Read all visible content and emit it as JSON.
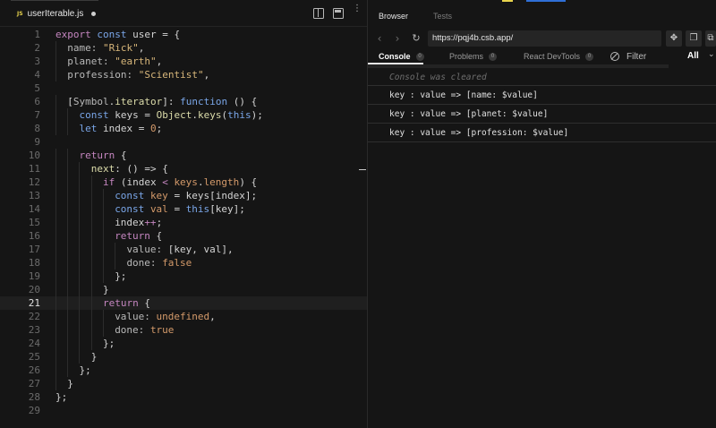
{
  "editor": {
    "tab": {
      "badge": "JS",
      "filename": "userIterable.js"
    },
    "active_line": 21,
    "lines": [
      {
        "n": "1",
        "indent": 0,
        "tokens": [
          [
            "k",
            "export "
          ],
          [
            "kv",
            "const "
          ],
          [
            "p",
            "user = {"
          ]
        ]
      },
      {
        "n": "2",
        "indent": 2,
        "tokens": [
          [
            "pr",
            "name: "
          ],
          [
            "s",
            "\"Rick\""
          ],
          [
            "p",
            ","
          ]
        ]
      },
      {
        "n": "3",
        "indent": 2,
        "tokens": [
          [
            "pr",
            "planet: "
          ],
          [
            "s",
            "\"earth\""
          ],
          [
            "p",
            ","
          ]
        ]
      },
      {
        "n": "4",
        "indent": 2,
        "tokens": [
          [
            "pr",
            "profession: "
          ],
          [
            "s",
            "\"Scientist\""
          ],
          [
            "p",
            ","
          ]
        ]
      },
      {
        "n": "5",
        "indent": 0,
        "tokens": []
      },
      {
        "n": "6",
        "indent": 2,
        "tokens": [
          [
            "p",
            "["
          ],
          [
            "pr",
            "Symbol"
          ],
          [
            "p",
            "."
          ],
          [
            "f",
            "iterator"
          ],
          [
            "p",
            "]: "
          ],
          [
            "kv",
            "function "
          ],
          [
            "p",
            "() {"
          ]
        ]
      },
      {
        "n": "7",
        "indent": 4,
        "tokens": [
          [
            "kv",
            "const "
          ],
          [
            "p",
            "keys = "
          ],
          [
            "f",
            "Object"
          ],
          [
            "p",
            "."
          ],
          [
            "f",
            "keys"
          ],
          [
            "p",
            "("
          ],
          [
            "kv",
            "this"
          ],
          [
            "p",
            ");"
          ]
        ]
      },
      {
        "n": "8",
        "indent": 4,
        "tokens": [
          [
            "kv",
            "let "
          ],
          [
            "p",
            "index = "
          ],
          [
            "v",
            "0"
          ],
          [
            "p",
            ";"
          ]
        ]
      },
      {
        "n": "9",
        "indent": 0,
        "tokens": []
      },
      {
        "n": "10",
        "indent": 4,
        "tokens": [
          [
            "k",
            "return "
          ],
          [
            "p",
            "{"
          ]
        ]
      },
      {
        "n": "11",
        "indent": 6,
        "tokens": [
          [
            "f",
            "next"
          ],
          [
            "p",
            ": () => {"
          ]
        ]
      },
      {
        "n": "12",
        "indent": 8,
        "tokens": [
          [
            "k",
            "if "
          ],
          [
            "p",
            "(index "
          ],
          [
            "op",
            "< "
          ],
          [
            "v",
            "keys"
          ],
          [
            "p",
            "."
          ],
          [
            "v",
            "length"
          ],
          [
            "p",
            ") {"
          ]
        ]
      },
      {
        "n": "13",
        "indent": 10,
        "tokens": [
          [
            "kv",
            "const "
          ],
          [
            "v",
            "key "
          ],
          [
            "p",
            "= keys[index];"
          ]
        ]
      },
      {
        "n": "14",
        "indent": 10,
        "tokens": [
          [
            "kv",
            "const "
          ],
          [
            "v",
            "val "
          ],
          [
            "p",
            "= "
          ],
          [
            "kv",
            "this"
          ],
          [
            "p",
            "[key];"
          ]
        ]
      },
      {
        "n": "15",
        "indent": 10,
        "tokens": [
          [
            "p",
            "index"
          ],
          [
            "op",
            "++"
          ],
          [
            "p",
            ";"
          ]
        ]
      },
      {
        "n": "16",
        "indent": 10,
        "tokens": [
          [
            "k",
            "return "
          ],
          [
            "p",
            "{"
          ]
        ]
      },
      {
        "n": "17",
        "indent": 12,
        "tokens": [
          [
            "pr",
            "value: "
          ],
          [
            "p",
            "[key, val],"
          ]
        ]
      },
      {
        "n": "18",
        "indent": 12,
        "tokens": [
          [
            "pr",
            "done: "
          ],
          [
            "v",
            "false"
          ]
        ]
      },
      {
        "n": "19",
        "indent": 10,
        "tokens": [
          [
            "p",
            "};"
          ]
        ]
      },
      {
        "n": "20",
        "indent": 8,
        "tokens": [
          [
            "p",
            "}"
          ]
        ]
      },
      {
        "n": "21",
        "indent": 8,
        "tokens": [
          [
            "k",
            "return "
          ],
          [
            "p",
            "{"
          ]
        ]
      },
      {
        "n": "22",
        "indent": 10,
        "tokens": [
          [
            "pr",
            "value: "
          ],
          [
            "v",
            "undefined"
          ],
          [
            "p",
            ","
          ]
        ]
      },
      {
        "n": "23",
        "indent": 10,
        "tokens": [
          [
            "pr",
            "done: "
          ],
          [
            "v",
            "true"
          ]
        ]
      },
      {
        "n": "24",
        "indent": 8,
        "tokens": [
          [
            "p",
            "};"
          ]
        ]
      },
      {
        "n": "25",
        "indent": 6,
        "tokens": [
          [
            "p",
            "}"
          ]
        ]
      },
      {
        "n": "26",
        "indent": 4,
        "tokens": [
          [
            "p",
            "};"
          ]
        ]
      },
      {
        "n": "27",
        "indent": 2,
        "tokens": [
          [
            "p",
            "}"
          ]
        ]
      },
      {
        "n": "28",
        "indent": 0,
        "tokens": [
          [
            "p",
            "};"
          ]
        ]
      },
      {
        "n": "29",
        "indent": 0,
        "tokens": []
      }
    ]
  },
  "browser": {
    "tabs": {
      "browser": "Browser",
      "tests": "Tests"
    },
    "url": "https://pqj4b.csb.app/",
    "console_tabs": {
      "console": {
        "label": "Console",
        "count": "0"
      },
      "problems": {
        "label": "Problems",
        "count": "0"
      },
      "devtools": {
        "label": "React DevTools",
        "count": "0"
      }
    },
    "filter_placeholder": "Filter",
    "level": "All",
    "console_lines": [
      {
        "kind": "cleared",
        "text": "Console was cleared"
      },
      {
        "kind": "log",
        "text": "key : value => [name: $value]"
      },
      {
        "kind": "log",
        "text": "key : value => [planet: $value]"
      },
      {
        "kind": "log",
        "text": "key : value => [profession: $value]"
      }
    ]
  },
  "colors": {
    "background": "#151515",
    "keyword": "#c586c0",
    "keyword_blue": "#7aa6e8",
    "string": "#d7b67a",
    "literal": "#d49a6a",
    "function": "#dcdcaa",
    "js_badge": "#e8d44d"
  },
  "icons": {
    "split": "split-editor-icon",
    "preview": "open-preview-icon",
    "more": "more-icon",
    "back": "arrow-left-icon",
    "forward": "arrow-right-icon",
    "reload": "reload-icon",
    "clear": "clear-console-icon"
  }
}
